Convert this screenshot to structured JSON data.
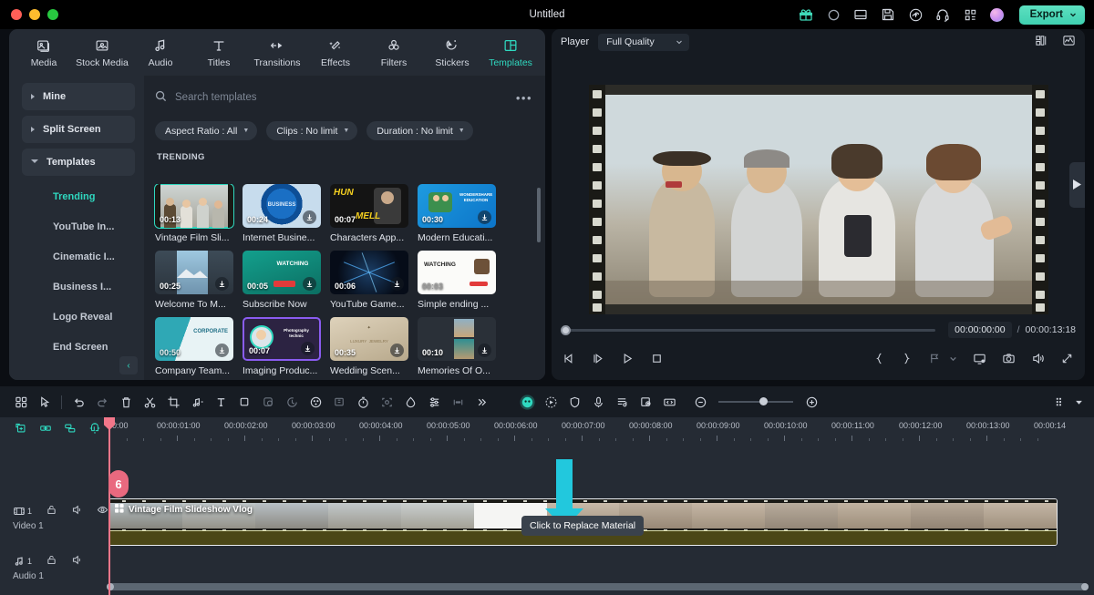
{
  "window": {
    "title": "Untitled"
  },
  "titlebar": {
    "icons": [
      "gift-icon",
      "record-circle-icon",
      "layout-icon",
      "save-icon",
      "cloud-upload-icon",
      "headset-icon",
      "grid-apps-icon"
    ],
    "export_label": "Export"
  },
  "tabs": [
    {
      "label": "Media",
      "icon": "media-icon",
      "active": false
    },
    {
      "label": "Stock Media",
      "icon": "stock-media-icon",
      "active": false
    },
    {
      "label": "Audio",
      "icon": "audio-note-icon",
      "active": false
    },
    {
      "label": "Titles",
      "icon": "titles-t-icon",
      "active": false
    },
    {
      "label": "Transitions",
      "icon": "transitions-icon",
      "active": false
    },
    {
      "label": "Effects",
      "icon": "effects-wand-icon",
      "active": false
    },
    {
      "label": "Filters",
      "icon": "filters-circles-icon",
      "active": false
    },
    {
      "label": "Stickers",
      "icon": "stickers-icon",
      "active": false
    },
    {
      "label": "Templates",
      "icon": "templates-grid-icon",
      "active": true
    }
  ],
  "sidebar": {
    "groups": [
      {
        "label": "Mine",
        "open": false
      },
      {
        "label": "Split Screen",
        "open": false
      },
      {
        "label": "Templates",
        "open": true
      }
    ],
    "items": [
      {
        "label": "Trending",
        "active": true
      },
      {
        "label": "YouTube In...",
        "active": false
      },
      {
        "label": "Cinematic I...",
        "active": false
      },
      {
        "label": "Business I...",
        "active": false
      },
      {
        "label": "Logo Reveal",
        "active": false
      },
      {
        "label": "End Screen",
        "active": false
      }
    ],
    "collapse_label": "‹"
  },
  "search": {
    "placeholder": "Search templates",
    "value": "",
    "more_label": "•••"
  },
  "filters": [
    {
      "label": "Aspect Ratio : All"
    },
    {
      "label": "Clips : No limit"
    },
    {
      "label": "Duration : No limit"
    }
  ],
  "section_label": "TRENDING",
  "templates": [
    [
      {
        "name": "Vintage Film Sli...",
        "duration": "00:13",
        "art": "t-vintage",
        "mini": "",
        "selected": true,
        "download": false
      },
      {
        "name": "Internet Busine...",
        "duration": "00:24",
        "art": "t-biz",
        "mini": "BUSINESS",
        "selected": false,
        "download": true
      },
      {
        "name": "Characters App...",
        "duration": "00:07",
        "art": "t-char",
        "mini": "HUN MELL",
        "selected": false,
        "download": false
      },
      {
        "name": "Modern Educati...",
        "duration": "00:30",
        "art": "t-edu",
        "mini": "WONDERSHARE EDUCATION",
        "selected": false,
        "download": true
      }
    ],
    [
      {
        "name": "Welcome To M...",
        "duration": "00:25",
        "art": "t-welcome",
        "mini": "",
        "selected": false,
        "download": true
      },
      {
        "name": "Subscribe Now",
        "duration": "00:05",
        "art": "t-subs",
        "mini": "WATCHING",
        "selected": false,
        "download": true
      },
      {
        "name": "YouTube Game...",
        "duration": "00:06",
        "art": "t-game",
        "mini": "",
        "selected": false,
        "download": true
      },
      {
        "name": "Simple ending ...",
        "duration": "00:03",
        "art": "t-simple",
        "mini": "WATCHING",
        "selected": false,
        "download": false
      }
    ],
    [
      {
        "name": "Company Team...",
        "duration": "00:50",
        "art": "t-corp",
        "mini": "CORPORATE",
        "selected": false,
        "download": true
      },
      {
        "name": "Imaging Produc...",
        "duration": "00:07",
        "art": "t-imaging",
        "mini": "Photography technic",
        "selected": false,
        "download": true
      },
      {
        "name": "Wedding Scen...",
        "duration": "00:35",
        "art": "t-wed",
        "mini": "",
        "selected": false,
        "download": true
      },
      {
        "name": "Memories Of O...",
        "duration": "00:10",
        "art": "t-mem",
        "mini": "",
        "selected": false,
        "download": true
      }
    ]
  ],
  "player": {
    "label": "Player",
    "quality": "Full Quality",
    "right_icons": [
      "compare-layout-icon",
      "waveform-scope-icon"
    ],
    "current_time": "00:00:00:00",
    "separator": "/",
    "total_time": "00:00:13:18",
    "controls": [
      "prev-frame-icon",
      "step-back-icon",
      "play-icon",
      "stop-icon"
    ],
    "right_controls": [
      "mark-in-icon",
      "mark-out-icon",
      "marker-icon",
      "chevron-down-icon",
      "screen-cast-icon",
      "snapshot-icon",
      "volume-icon",
      "fullscreen-icon"
    ],
    "overlay_play": "play-triangle-icon"
  },
  "timeline_toolbar": {
    "left_icons": [
      "grid-view-icon",
      "select-cursor-icon",
      "undo-icon",
      "redo-icon",
      "delete-icon",
      "split-scissors-icon",
      "crop-icon",
      "audio-detach-icon",
      "text-icon",
      "shape-icon",
      "mask-icon",
      "speed-icon",
      "color-icon",
      "keyframe-icon",
      "stopwatch-icon",
      "motion-track-icon",
      "chroma-key-icon",
      "adjust-sliders-icon",
      "more-dots-icon",
      "chevron-right-icon"
    ],
    "right_icons": [
      "ai-portrait-icon",
      "auto-reframe-icon",
      "shield-icon",
      "voiceover-icon",
      "playlist-icon",
      "screen-record-icon",
      "split-screen-icon"
    ],
    "zoom_out": "minus-icon",
    "zoom_in": "plus-icon",
    "render_icon": "render-grid-icon"
  },
  "track_tools": [
    "add-track-icon",
    "link-icon",
    "group-icon",
    "magnet-icon"
  ],
  "ruler_ticks": [
    "00:00",
    "00:00:01:00",
    "00:00:02:00",
    "00:00:03:00",
    "00:00:04:00",
    "00:00:05:00",
    "00:00:06:00",
    "00:00:07:00",
    "00:00:08:00",
    "00:00:09:00",
    "00:00:10:00",
    "00:00:11:00",
    "00:00:12:00",
    "00:00:13:00",
    "00:00:14"
  ],
  "tracks": [
    {
      "number": "1",
      "name": "Video 1",
      "type": "video",
      "icons": [
        "video-track-icon",
        "lock-icon",
        "mute-icon",
        "eye-icon"
      ]
    },
    {
      "number": "1",
      "name": "Audio 1",
      "type": "audio",
      "icons": [
        "audio-track-icon",
        "lock-icon",
        "mute-icon"
      ]
    }
  ],
  "clip": {
    "label": "Vintage Film Slideshow Vlog",
    "icon": "template-clip-icon"
  },
  "tooltip": {
    "text": "Click to Replace Material"
  },
  "arrow": {
    "color": "#22c8dd"
  },
  "colors": {
    "accent": "#2fd9c0",
    "playhead": "#f2778a",
    "export": "#4fd8b8",
    "panel": "#252b34",
    "bg": "#1f242c"
  }
}
